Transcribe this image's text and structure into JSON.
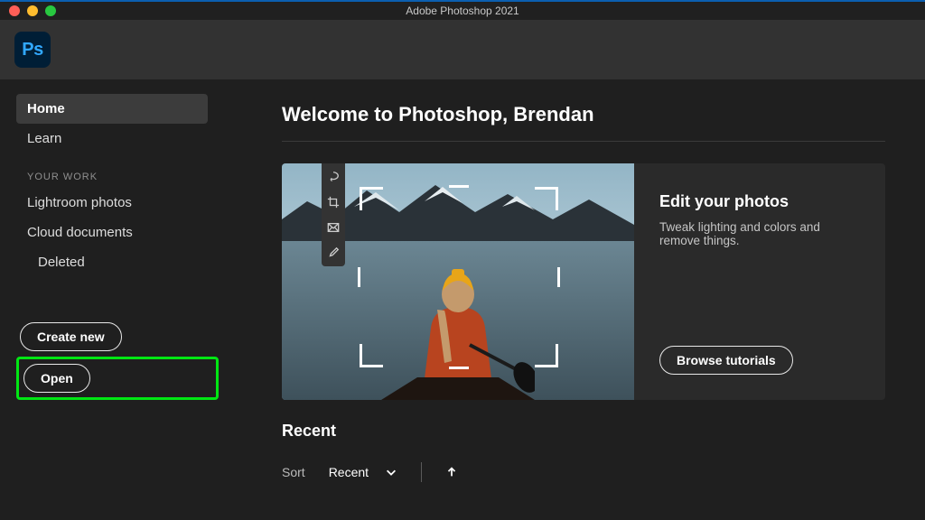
{
  "window": {
    "title": "Adobe Photoshop 2021"
  },
  "app_icon": "Ps",
  "sidebar": {
    "items": [
      {
        "label": "Home",
        "active": true
      },
      {
        "label": "Learn",
        "active": false
      }
    ],
    "work_header": "YOUR WORK",
    "work_items": [
      {
        "label": "Lightroom photos"
      },
      {
        "label": "Cloud documents"
      },
      {
        "label": "Deleted",
        "indent": true
      }
    ],
    "create_label": "Create new",
    "open_label": "Open"
  },
  "main": {
    "welcome": "Welcome to Photoshop, Brendan",
    "card": {
      "title": "Edit your photos",
      "subtitle": "Tweak lighting and colors and remove things.",
      "button": "Browse tutorials"
    },
    "recent": {
      "heading": "Recent",
      "sort_label": "Sort",
      "sort_value": "Recent"
    }
  }
}
